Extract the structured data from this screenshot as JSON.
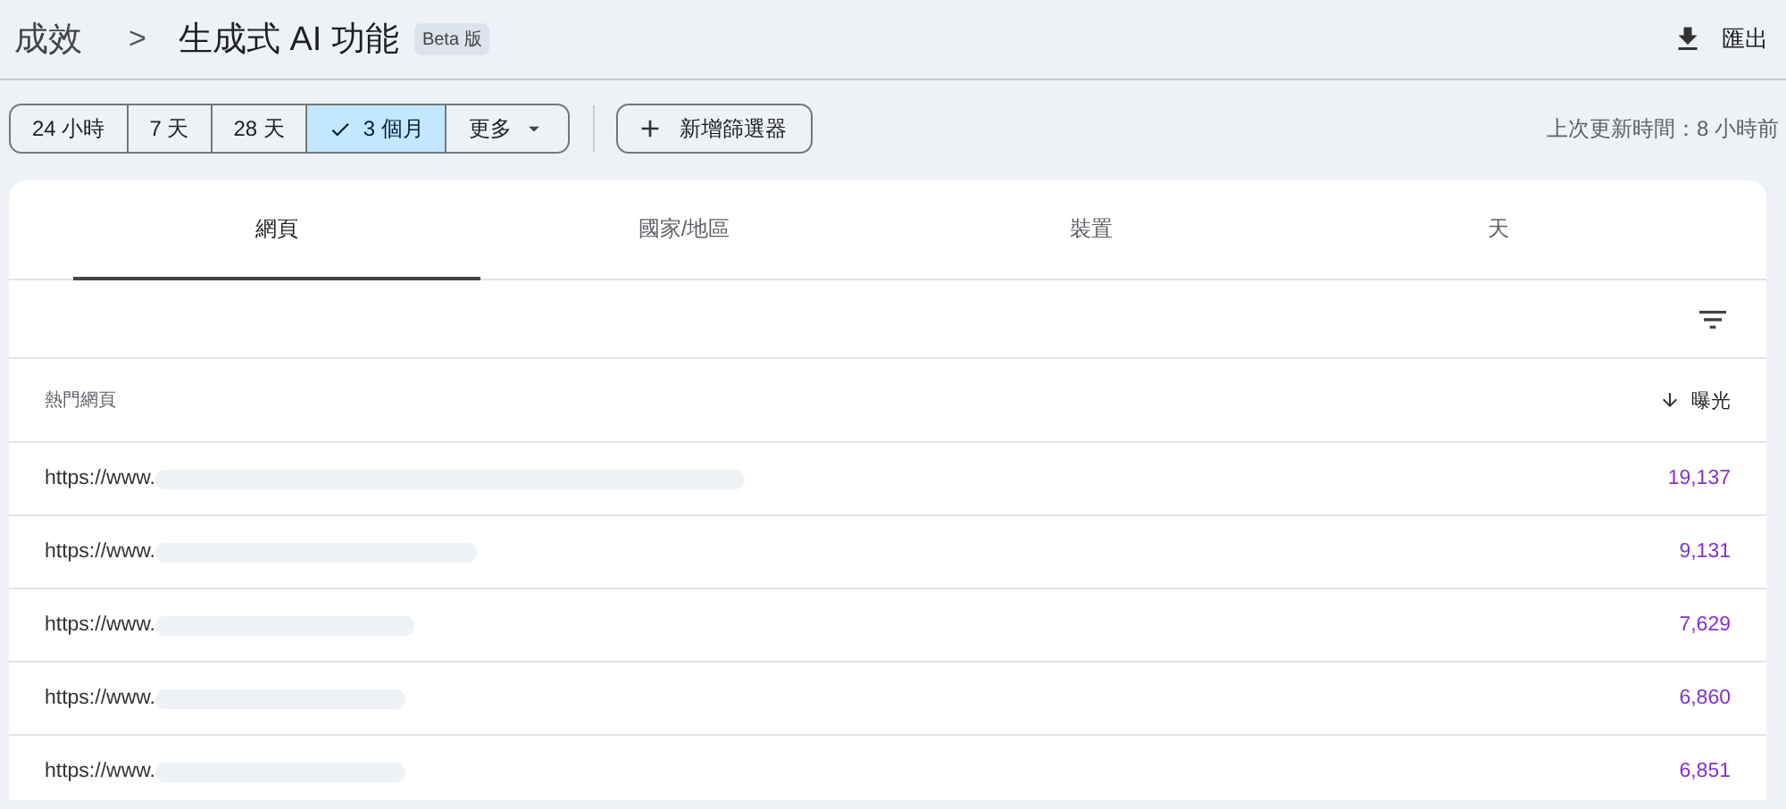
{
  "breadcrumb": {
    "parent": "成效",
    "separator": ">",
    "title": "生成式 AI 功能",
    "badge": "Beta 版"
  },
  "export": {
    "label": "匯出"
  },
  "date_ranges": [
    {
      "label": "24 小時",
      "selected": false
    },
    {
      "label": "7 天",
      "selected": false
    },
    {
      "label": "28 天",
      "selected": false
    },
    {
      "label": "3 個月",
      "selected": true
    },
    {
      "label": "更多",
      "selected": false,
      "kind": "dropdown"
    }
  ],
  "add_filter": {
    "label": "新增篩選器"
  },
  "last_updated": "上次更新時間：8 小時前",
  "tabs": [
    {
      "label": "網頁",
      "selected": true
    },
    {
      "label": "國家/地區",
      "selected": false
    },
    {
      "label": "裝置",
      "selected": false
    },
    {
      "label": "天",
      "selected": false
    }
  ],
  "table": {
    "columns": [
      {
        "label": "熱門網頁",
        "sorted": false
      },
      {
        "label": "曝光",
        "sorted": true
      }
    ],
    "rows": [
      {
        "page": "https://www.",
        "impressions": "19,137"
      },
      {
        "page": "https://www.",
        "impressions": "9,131"
      },
      {
        "page": "https://www.",
        "impressions": "7,629"
      },
      {
        "page": "https://www.",
        "impressions": "6,860"
      },
      {
        "page": "https://www.",
        "impressions": "6,851"
      }
    ]
  }
}
